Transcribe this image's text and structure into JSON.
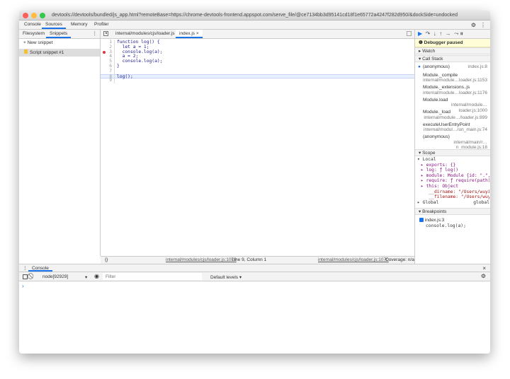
{
  "window": {
    "title": "devtools://devtools/bundled/js_app.html?remoteBase=https://chrome-devtools-frontend.appspot.com/serve_file/@ce7134bb3d95141cd18f1e65772a4247f282d950/&dockSide=undocked"
  },
  "main_tabs": [
    "Console",
    "Sources",
    "Memory",
    "Profiler"
  ],
  "navigator": {
    "tabs": [
      "Filesystem",
      "Snippets"
    ],
    "new_snippet": "+ New snippet",
    "snippet": "Script snippet #1"
  },
  "editor": {
    "tabs": [
      "internal/modules/cjs/loader.js",
      "index.js ×"
    ],
    "lines": [
      "function log() {",
      "  let a = 1;",
      "  console.log(a);",
      "  a = 2;",
      "  console.log(a);",
      "}",
      "",
      "log();",
      ""
    ],
    "status": {
      "braces": "{}",
      "link1": "internal/modules/cjs/loader.js:1070",
      "position": "Line 9, Column 1",
      "link2": "internal/modules/cjs/loader.js:1070",
      "coverage": "Coverage: n/a"
    }
  },
  "debugger": {
    "paused": "Debugger paused",
    "watch": "Watch",
    "call_stack": "Call Stack",
    "frames": [
      {
        "name": "(anonymous)",
        "loc": "index.js:8"
      },
      {
        "name": "Module._compile",
        "loc": "internal/module…loader.js:1153"
      },
      {
        "name": "Module._extensions..js",
        "loc": "internal/module…loader.js:1176"
      },
      {
        "name": "Module.load",
        "loc": "internal/module…loader.js:1000"
      },
      {
        "name": "Module._load",
        "loc": "internal/module…/loader.js:899"
      },
      {
        "name": "executeUserEntryPoint",
        "loc": "internal/modul…run_main.js:74"
      },
      {
        "name": "(anonymous)",
        "loc": "internal/main/r…n_module.js:18"
      }
    ],
    "scope": "Scope",
    "local": "Local",
    "vars": [
      "▸ exports: {}",
      "▸ log: ƒ log()",
      "▸ module: Module {id: \".\", …",
      "▸ require: ƒ require(path)",
      "▸ this: Object",
      "   __dirname: \"/Users/wuyiqi…",
      "   __filename: \"/Users/wuyiq…"
    ],
    "global": "Global",
    "global_val": "global",
    "breakpoints": "Breakpoints",
    "bp_file": "index.js:3",
    "bp_code": "console.log(a);"
  },
  "drawer": {
    "tab": "Console",
    "context": "node[92929]",
    "filter_placeholder": "Filter",
    "levels": "Default levels ▾",
    "prompt": "›"
  },
  "colors": {
    "accent": "#1a73e8",
    "paused_bg": "#fffdd7",
    "breakpoint": "#e0343c"
  }
}
